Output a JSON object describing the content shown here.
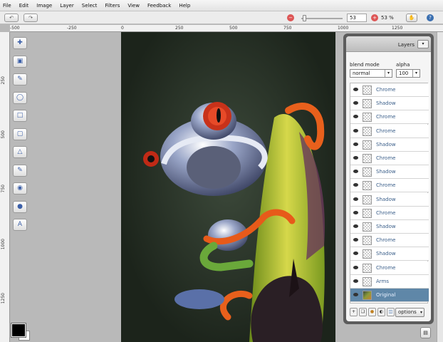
{
  "menu": [
    "File",
    "Edit",
    "Image",
    "Layer",
    "Select",
    "Filters",
    "View",
    "Feedback",
    "Help"
  ],
  "toolbar": {
    "zoom_value": "53",
    "zoom_percent": "53 %"
  },
  "ruler_top": [
    "-500",
    "-250",
    "0",
    "250",
    "500",
    "750",
    "1000",
    "1250"
  ],
  "ruler_left": [
    "250",
    "500",
    "750",
    "1000",
    "1250"
  ],
  "tools": [
    "move-selection-tool",
    "crop-tool",
    "color-picker-tool",
    "lasso-tool",
    "rect-select-tool",
    "eraser-tool",
    "clone-stamp-tool",
    "brush-tool",
    "burn-tool",
    "sponge-tool",
    "type-tool"
  ],
  "panel": {
    "title": "Layers",
    "blend_mode_label": "blend mode",
    "alpha_label": "alpha",
    "blend_mode_value": "normal",
    "alpha_value": "100",
    "options_label": "options"
  },
  "layers": [
    {
      "name": "Chrome"
    },
    {
      "name": "Shadow"
    },
    {
      "name": "Chrome"
    },
    {
      "name": "Chrome"
    },
    {
      "name": "Shadow"
    },
    {
      "name": "Chrome"
    },
    {
      "name": "Shadow"
    },
    {
      "name": "Chrome"
    },
    {
      "name": "Shadow"
    },
    {
      "name": "Chrome"
    },
    {
      "name": "Shadow"
    },
    {
      "name": "Chrome"
    },
    {
      "name": "Shadow"
    },
    {
      "name": "Chrome"
    },
    {
      "name": "Arms"
    },
    {
      "name": "Original",
      "active": true
    }
  ],
  "colors": {
    "accent": "#5f87a8",
    "panel_bg": "#5c5c5c"
  }
}
